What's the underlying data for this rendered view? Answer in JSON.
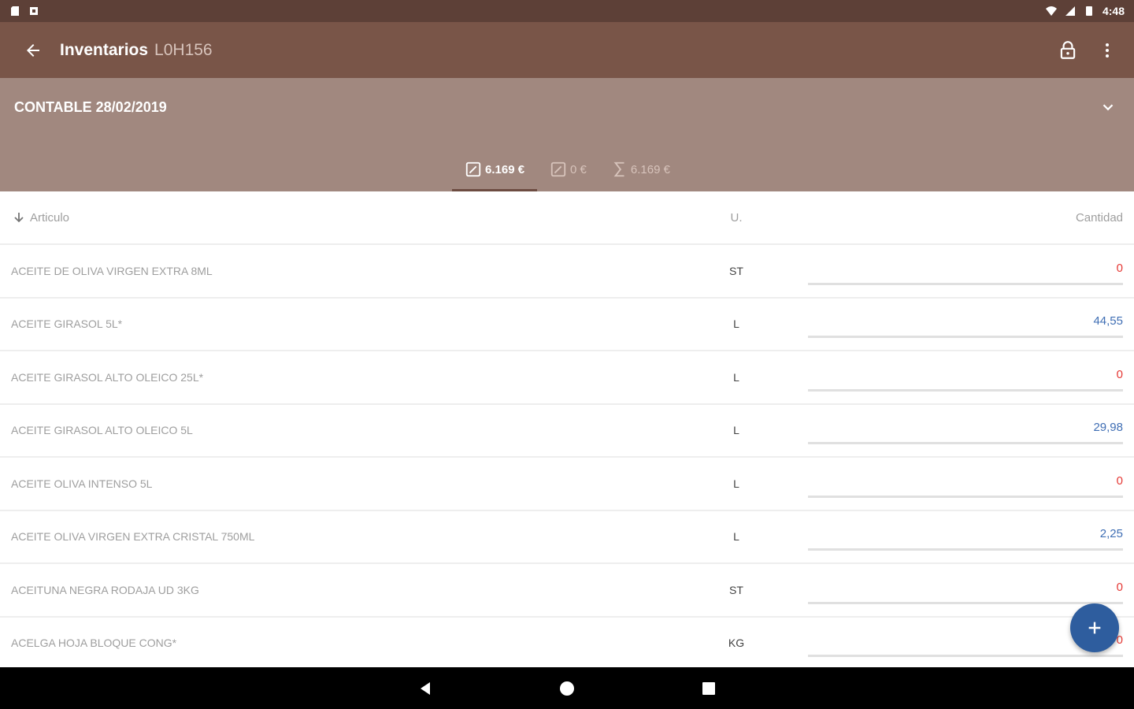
{
  "status_bar": {
    "time": "4:48"
  },
  "app_bar": {
    "title": "Inventarios",
    "subtitle": "L0H156"
  },
  "filter": {
    "title": "CONTABLE 28/02/2019"
  },
  "tabs": [
    {
      "label": "6.169 €",
      "icon": "edit-square-icon",
      "active": true
    },
    {
      "label": "0 €",
      "icon": "edit-square-icon",
      "active": false
    },
    {
      "label": "6.169 €",
      "icon": "sigma-icon",
      "active": false
    }
  ],
  "list_header": {
    "article": "Articulo",
    "unit": "U.",
    "quantity": "Cantidad"
  },
  "rows": [
    {
      "name": "ACEITE DE OLIVA VIRGEN EXTRA 8ML",
      "unit": "ST",
      "qty": "0",
      "zero": true
    },
    {
      "name": "ACEITE GIRASOL 5L*",
      "unit": "L",
      "qty": "44,55",
      "zero": false
    },
    {
      "name": "ACEITE GIRASOL ALTO OLEICO 25L*",
      "unit": "L",
      "qty": "0",
      "zero": true
    },
    {
      "name": "ACEITE GIRASOL ALTO OLEICO 5L",
      "unit": "L",
      "qty": "29,98",
      "zero": false
    },
    {
      "name": "ACEITE OLIVA INTENSO 5L",
      "unit": "L",
      "qty": "0",
      "zero": true
    },
    {
      "name": "ACEITE OLIVA VIRGEN EXTRA CRISTAL 750ML",
      "unit": "L",
      "qty": "2,25",
      "zero": false
    },
    {
      "name": "ACEITUNA NEGRA RODAJA UD 3KG",
      "unit": "ST",
      "qty": "0",
      "zero": true
    },
    {
      "name": "ACELGA HOJA BLOQUE CONG*",
      "unit": "KG",
      "qty": "0",
      "zero": true
    }
  ],
  "colors": {
    "status_bar": "#5d4037",
    "app_bar": "#795548",
    "filter_panel": "#a1887f",
    "fab": "#2e5d9e",
    "qty_zero": "#e53935",
    "qty_positive": "#3f6eb4"
  }
}
